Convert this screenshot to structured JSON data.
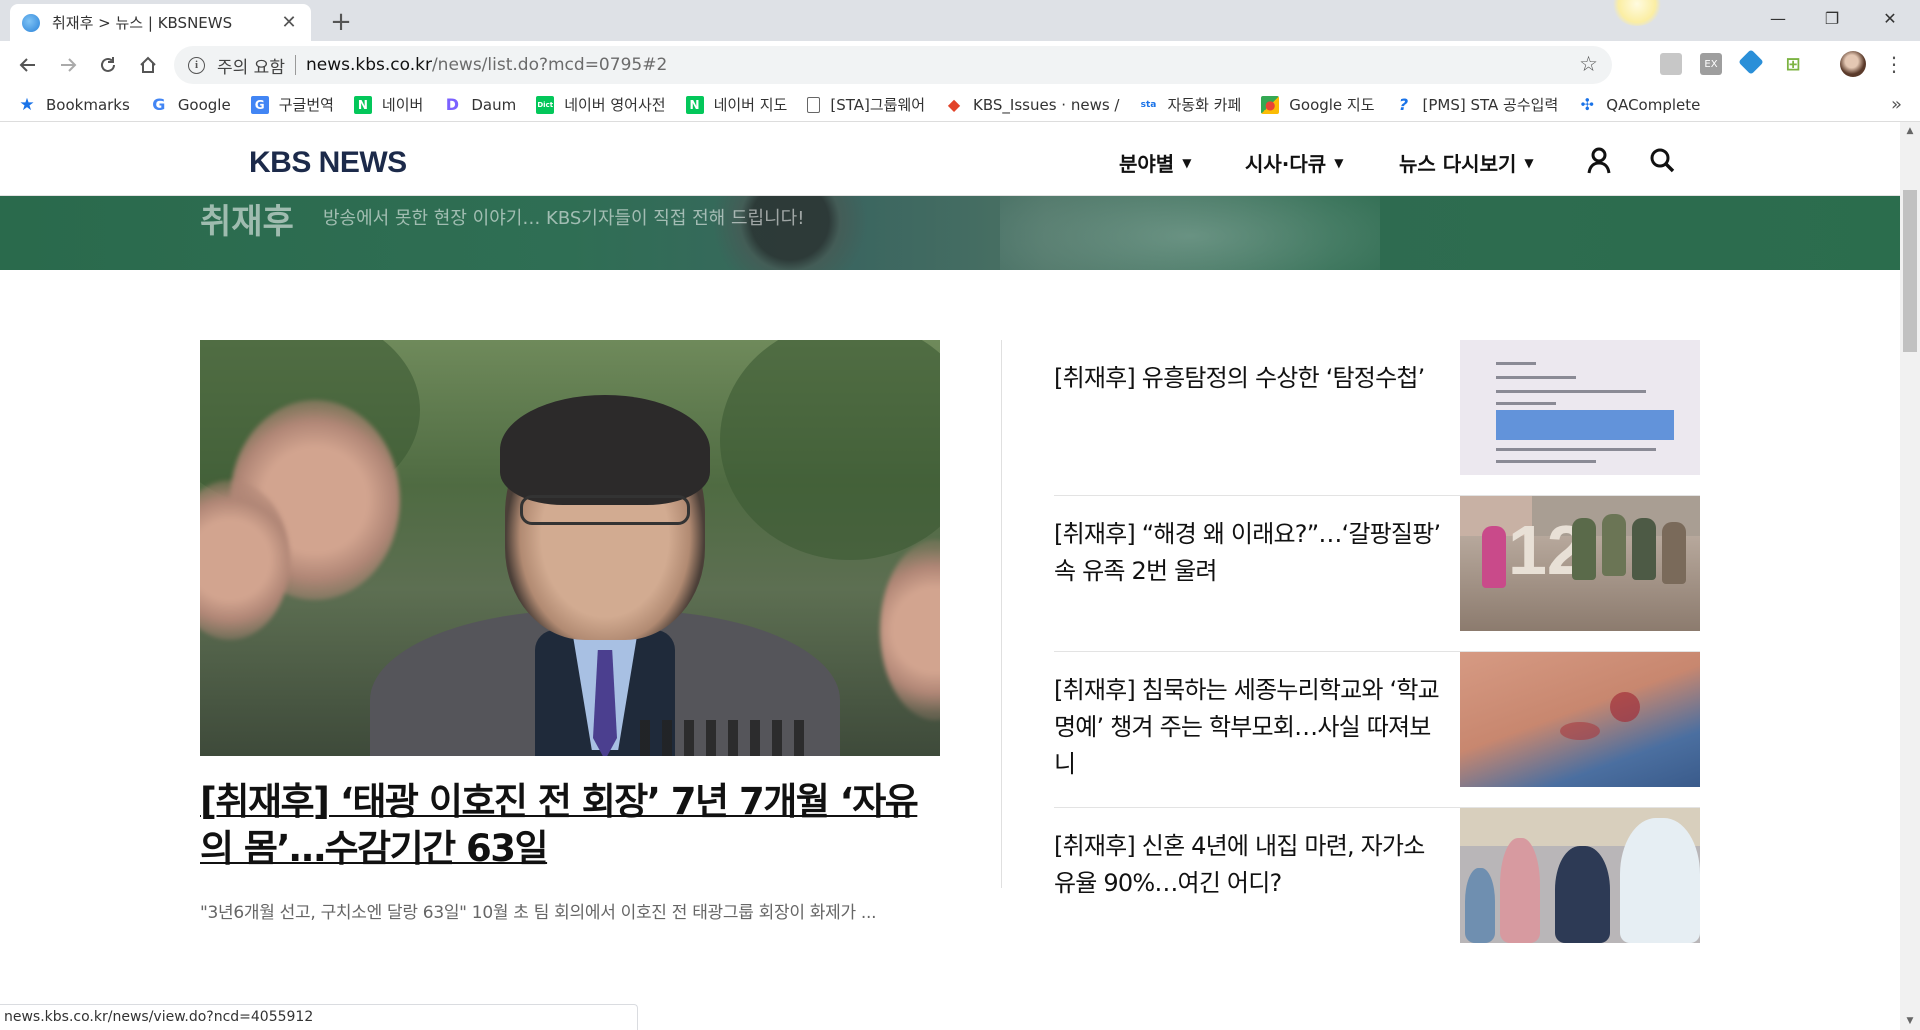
{
  "browser": {
    "tab_title": "취재후 > 뉴스 | KBSNEWS",
    "tab_close": "✕",
    "new_tab": "+",
    "url_security": "주의 요함",
    "url_host": "news.kbs.co.kr",
    "url_path": "/news/list.do?mcd=0795#2",
    "window_controls": [
      "—",
      "❐",
      "✕"
    ],
    "status_url": "news.kbs.co.kr/news/view.do?ncd=4055912"
  },
  "bookmarks": [
    {
      "label": "Bookmarks",
      "icon": "star-icon",
      "color": "#1a73e8"
    },
    {
      "label": "Google",
      "icon": "google-icon",
      "color": "#4285f4"
    },
    {
      "label": "구글번역",
      "icon": "translate-icon",
      "color": "#4285f4"
    },
    {
      "label": "네이버",
      "icon": "naver-icon",
      "color": "#03c75a"
    },
    {
      "label": "Daum",
      "icon": "daum-icon",
      "color": "#7b61ff"
    },
    {
      "label": "네이버 영어사전",
      "icon": "dict-icon",
      "color": "#03c75a"
    },
    {
      "label": "네이버 지도",
      "icon": "naver-icon",
      "color": "#03c75a"
    },
    {
      "label": "[STA]그룹웨어",
      "icon": "page-icon",
      "color": "#666666"
    },
    {
      "label": "KBS_Issues · news /",
      "icon": "gitlab-icon",
      "color": "#e24329"
    },
    {
      "label": "자동화 카페",
      "icon": "cafe-icon",
      "color": "#1a73e8"
    },
    {
      "label": "Google 지도",
      "icon": "maps-icon",
      "color": "#34a853"
    },
    {
      "label": "[PMS] STA 공수입력",
      "icon": "pms-icon",
      "color": "#1a73e8"
    },
    {
      "label": "QAComplete",
      "icon": "qacomplete-icon",
      "color": "#1a73e8"
    }
  ],
  "bookmarks_more": "»",
  "site": {
    "logo": "KBS NEWS",
    "nav": [
      {
        "label": "분야별"
      },
      {
        "label": "시사·다큐"
      },
      {
        "label": "뉴스 다시보기"
      }
    ],
    "banner_title": "취재후",
    "banner_subtitle": "방송에서 못한 현장 이야기… KBS기자들이 직접 전해 드립니다!"
  },
  "lead_article": {
    "title": "[취재후] ‘태광 이호진 전 회장’ 7년 7개월 ‘자유의 몸’…수감기간 63일",
    "summary": "\"3년6개월 선고, 구치소엔 달랑 63일\" 10월 초 팀 회의에서 이호진 전 태광그룹 회장이 화제가 ..."
  },
  "side_articles": [
    {
      "title": "[취재후] 유흥탐정의 수상한 ‘탐정수첩’"
    },
    {
      "title": "[취재후] “해경 왜 이래요?”…‘갈팡질팡’ 속 유족 2번 울려"
    },
    {
      "title": "[취재후] 침묵하는 세종누리학교와 ‘학교 명예’ 챙겨 주는 학부모회…사실 따져보니"
    },
    {
      "title": "[취재후] 신혼 4년에 내집 마련, 자가소유율 90%…여긴 어디?"
    }
  ],
  "colors": {
    "logo": "#1c2a4a",
    "banner": "#2b6d4d",
    "tabstrip": "#dee1e6"
  }
}
